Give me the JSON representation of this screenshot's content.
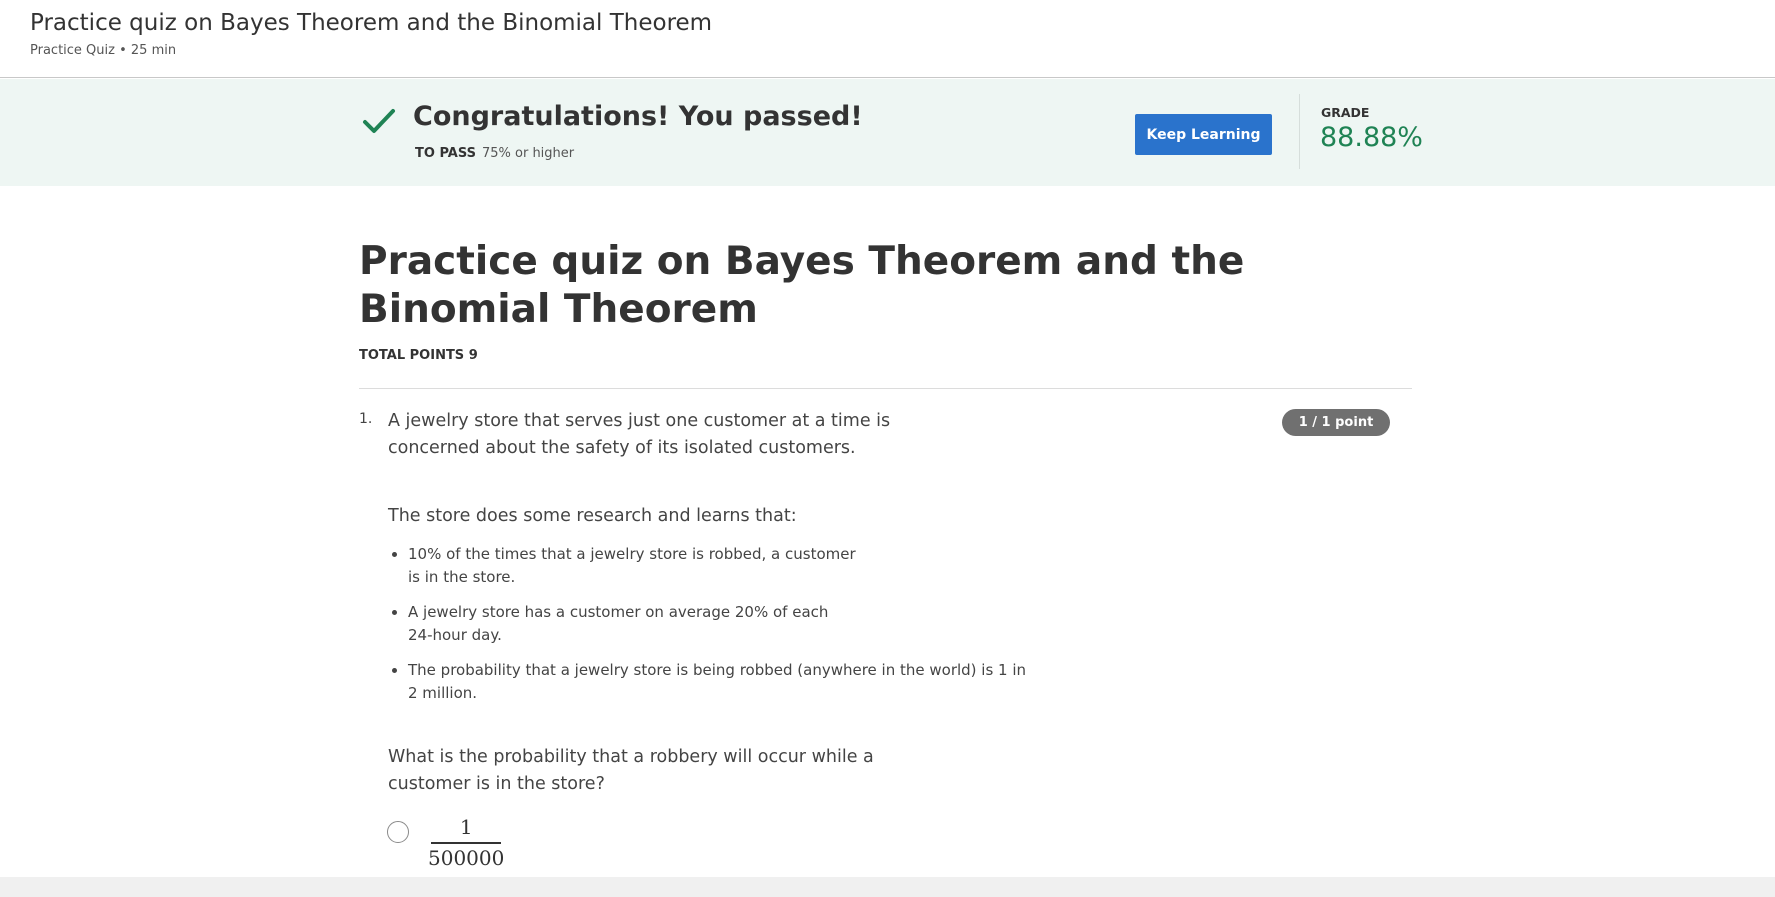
{
  "header": {
    "title": "Practice quiz on Bayes Theorem and the Binomial Theorem",
    "subtitle": "Practice Quiz • 25 min"
  },
  "banner": {
    "heading": "Congratulations! You passed!",
    "to_pass_label": "TO PASS",
    "to_pass_value": "75% or higher",
    "keep_learning_label": "Keep Learning",
    "grade_label": "GRADE",
    "grade_value": "88.88%",
    "accent_color": "#1f8354",
    "button_color": "#2a73cc"
  },
  "quiz": {
    "title": "Practice quiz on Bayes Theorem and the Binomial Theorem",
    "total_points": "TOTAL POINTS 9",
    "questions": [
      {
        "number": "1.",
        "points": "1 / 1 point",
        "intro": "A jewelry store that serves just one customer at a time is concerned about the safety of its isolated customers.",
        "research": "The store does some research and learns that:",
        "bullets": [
          "10% of the times that a jewelry store is robbed, a customer is in the store.",
          "A jewelry store has a customer on average 20% of each 24-hour day.",
          "The probability that a jewelry store is being robbed (anywhere in the world) is 1 in 2 million."
        ],
        "question": "What is the probability that a robbery will occur while a customer is in the store?",
        "options": [
          {
            "numerator": "1",
            "denominator": "500000",
            "selected": false
          }
        ]
      }
    ]
  }
}
